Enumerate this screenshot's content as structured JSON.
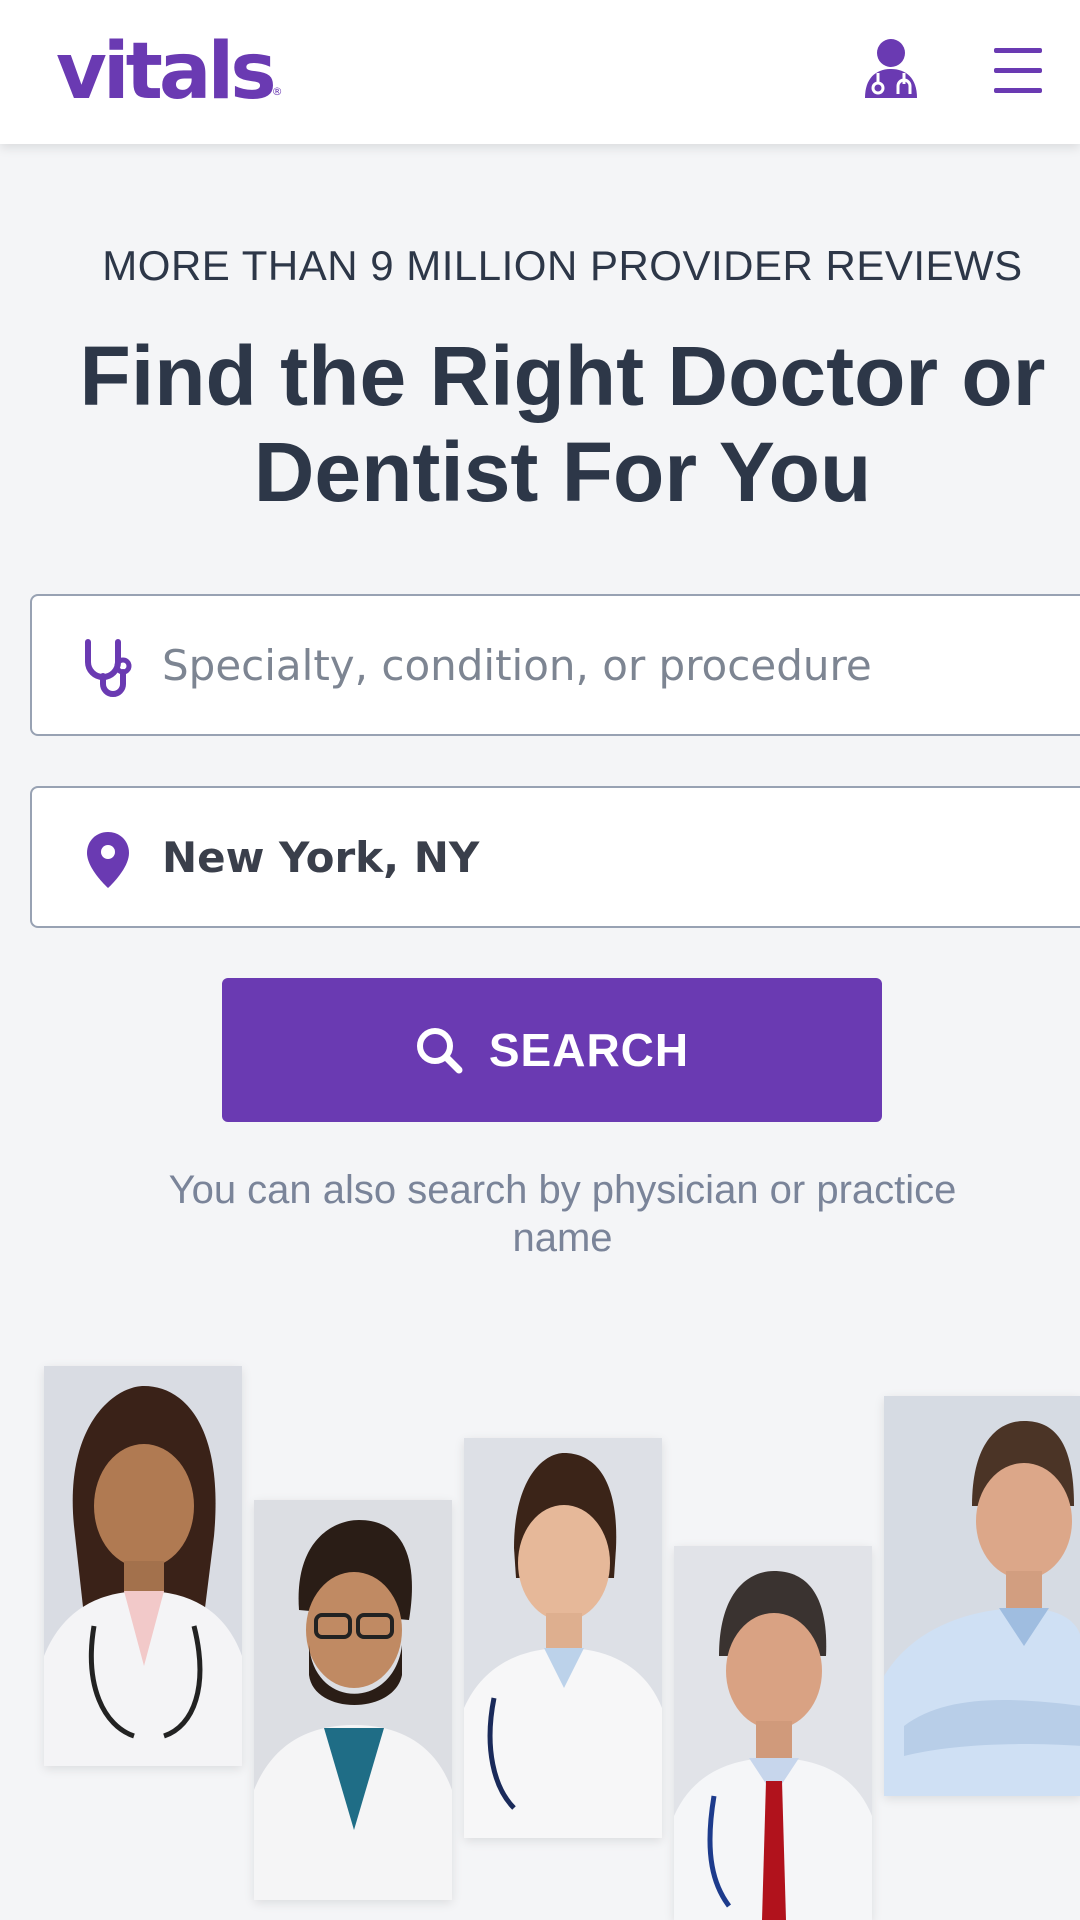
{
  "header": {
    "logo_text": "vitals",
    "logo_mark": "®",
    "brand_color": "#6a3ab2",
    "icons": [
      "doctor-profile-icon",
      "hamburger-menu-icon"
    ]
  },
  "hero": {
    "eyebrow": "MORE THAN 9 MILLION PROVIDER REVIEWS",
    "headline": "Find the Right Doctor or Dentist For You"
  },
  "search": {
    "specialty_placeholder": "Specialty, condition, or procedure",
    "specialty_value": "",
    "location_value": "New York, NY",
    "button_label": "SEARCH",
    "alt_text": "You can also search by physician or practice name"
  },
  "doctors": [
    {
      "name": "doctor-photo-1"
    },
    {
      "name": "doctor-photo-2"
    },
    {
      "name": "doctor-photo-3"
    },
    {
      "name": "doctor-photo-4"
    },
    {
      "name": "doctor-photo-5"
    }
  ]
}
